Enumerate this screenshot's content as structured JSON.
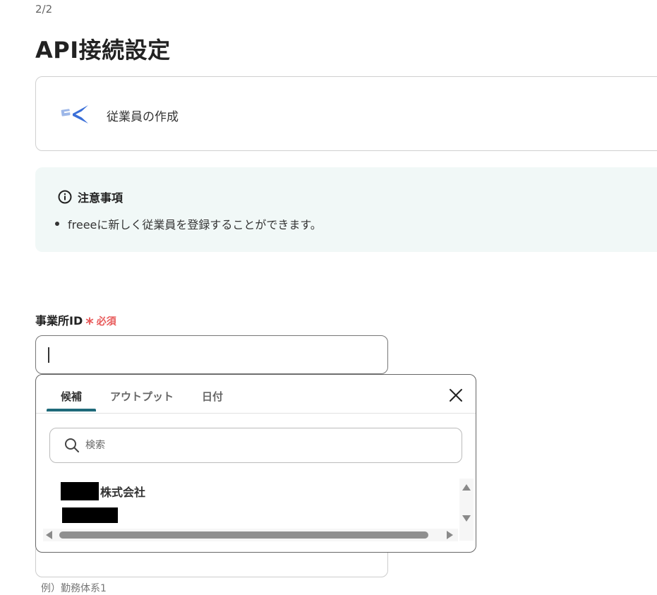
{
  "header": {
    "step": "2/2",
    "title": "API接続設定"
  },
  "action": {
    "label": "従業員の作成",
    "icon": "freee-bird-icon"
  },
  "notice": {
    "title": "注意事項",
    "items": [
      "freeeに新しく従業員を登録することができます。"
    ]
  },
  "field": {
    "label": "事業所ID",
    "required_mark": "*",
    "required_text": "必須",
    "value": ""
  },
  "dropdown": {
    "tabs": [
      {
        "label": "候補",
        "active": true
      },
      {
        "label": "アウトプット",
        "active": false
      },
      {
        "label": "日付",
        "active": false
      }
    ],
    "search_placeholder": "検索",
    "items": [
      {
        "label_suffix": "株式会社",
        "redacted": true
      }
    ],
    "accent_color": "#1f6a7a"
  },
  "next_field": {
    "example": "例）勤務体系1"
  },
  "colors": {
    "required": "#e85a5a",
    "notice_bg": "#f1f8f7",
    "tab_accent": "#1f6a7a"
  }
}
